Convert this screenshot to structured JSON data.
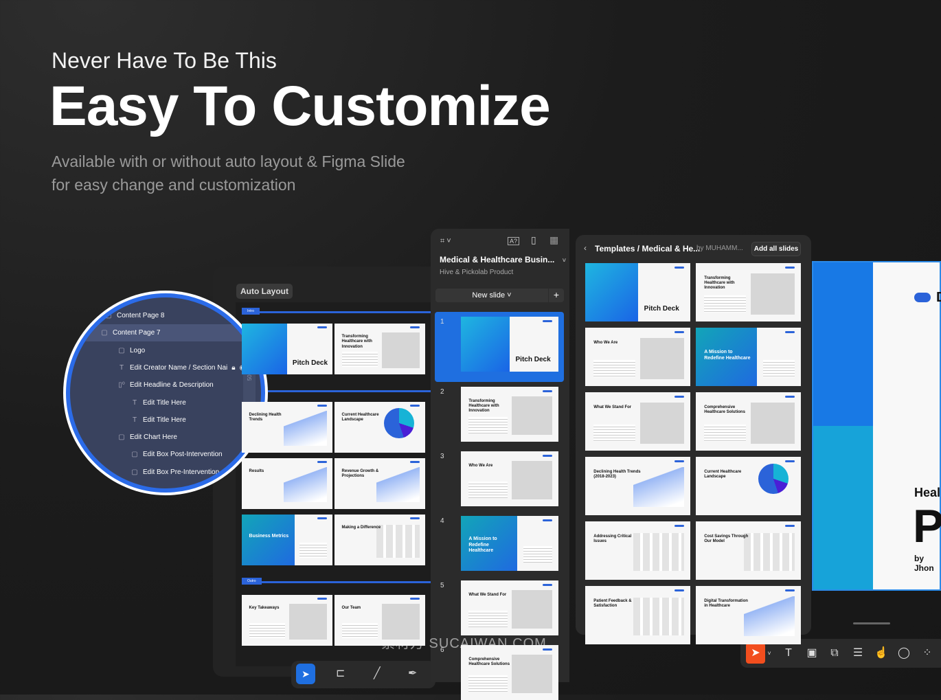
{
  "hero": {
    "pre": "Never Have To Be This",
    "main": "Easy To Customize",
    "sub1": "Available with or without auto layout  & Figma Slide",
    "sub2": "for easy change and customization"
  },
  "left_panel": {
    "tag": "Auto Layout",
    "sections": [
      "Intro",
      "Outro"
    ],
    "layers": [
      {
        "label": "Content Page 8",
        "icon": "frame",
        "indent": 0
      },
      {
        "label": "Content Page 7",
        "icon": "frame",
        "indent": 0,
        "selected": true
      },
      {
        "label": "Logo",
        "icon": "frame",
        "indent": 1
      },
      {
        "label": "Edit Creator Name / Section Nai",
        "icon": "text",
        "indent": 1
      },
      {
        "label": "Edit Headline & Description",
        "icon": "autolayout",
        "indent": 1
      },
      {
        "label": "Edit Title Here",
        "icon": "text",
        "indent": 2
      },
      {
        "label": "Edit Title Here",
        "icon": "text",
        "indent": 2
      },
      {
        "label": "Edit Chart Here",
        "icon": "frame",
        "indent": 1
      },
      {
        "label": "Edit Box Post-Intervention",
        "icon": "frame",
        "indent": 2
      },
      {
        "label": "Edit Box Pre-Intervention",
        "icon": "frame",
        "indent": 2
      }
    ],
    "ruler": [
      "500",
      "750"
    ],
    "thumbs": [
      {
        "v": "cover",
        "t": "Pitch Deck"
      },
      {
        "v": "text-image",
        "t": "Transforming Healthcare with Innovation"
      },
      {
        "v": "chart",
        "t": "Declining Health Trends"
      },
      {
        "v": "pie",
        "t": "Current Healthcare Landscape"
      },
      {
        "v": "chart",
        "t": "Results"
      },
      {
        "v": "chart",
        "t": "Revenue Growth & Projections"
      },
      {
        "v": "teal",
        "t": "Business Metrics"
      },
      {
        "v": "bars",
        "t": "Making a Difference"
      },
      {
        "v": "text-image",
        "t": "Key Takeaways"
      },
      {
        "v": "text-image",
        "t": "Our Team"
      }
    ]
  },
  "middle_panel": {
    "title": "Medical & Healthcare Busin...",
    "subtitle": "Hive & Pickolab Product",
    "new_slide": "New slide",
    "add": "+",
    "slides": [
      {
        "n": "1",
        "v": "cover",
        "t": "Pitch Deck"
      },
      {
        "n": "2",
        "v": "text-image",
        "t": "Transforming Healthcare with Innovation"
      },
      {
        "n": "3",
        "v": "text-image",
        "t": "Who We Are"
      },
      {
        "n": "4",
        "v": "teal",
        "t": "A Mission to Redefine Healthcare"
      },
      {
        "n": "5",
        "v": "text-image",
        "t": "What We Stand For"
      },
      {
        "n": "6",
        "v": "text-image",
        "t": "Comprehensive Healthcare Solutions"
      }
    ]
  },
  "right_panel": {
    "breadcrumb": "Templates / Medical & He...",
    "by": "by MUHAMM...",
    "add_all": "Add all slides",
    "slides": [
      {
        "v": "cover",
        "t": "Pitch Deck"
      },
      {
        "v": "text-image",
        "t": "Transforming Healthcare with Innovation"
      },
      {
        "v": "text-image",
        "t": "Who We Are"
      },
      {
        "v": "teal",
        "t": "A Mission to Redefine Healthcare"
      },
      {
        "v": "text-image",
        "t": "What We Stand For"
      },
      {
        "v": "text-image",
        "t": "Comprehensive Healthcare Solutions"
      },
      {
        "v": "chart",
        "t": "Declining Health Trends (2018-2023)"
      },
      {
        "v": "pie",
        "t": "Current Healthcare Landscape"
      },
      {
        "v": "bars",
        "t": "Addressing Critical Issues"
      },
      {
        "v": "bars",
        "t": "Cost Savings Through Our Model"
      },
      {
        "v": "bars",
        "t": "Patient Feedback & Satisfaction"
      },
      {
        "v": "chart",
        "t": "Digital Transformation in Healthcare"
      }
    ]
  },
  "big_slide": {
    "logo": "D",
    "kicker": "Heal",
    "title": "P",
    "author": "by Jhon"
  },
  "toolbar": [
    "move-icon",
    "text-icon",
    "image-icon",
    "shapes-icon",
    "table-icon",
    "interaction-icon",
    "comment-icon",
    "plugins-icon"
  ],
  "watermark": "素材万 SUCAIWAN.COM",
  "colors": {
    "accent": "#2b6be8",
    "tool_active": "#f24e1e"
  }
}
